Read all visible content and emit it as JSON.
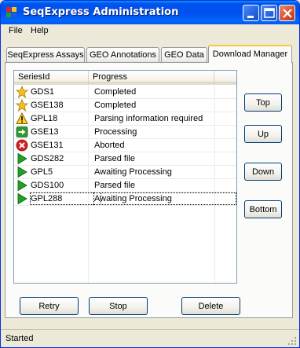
{
  "window": {
    "title": "SeqExpress Administration"
  },
  "menu": {
    "items": [
      "File",
      "Help"
    ]
  },
  "tabs": [
    "SeqExpress Assays",
    "GEO Annotations",
    "GEO Data",
    "Download Manager"
  ],
  "active_tab": "Download Manager",
  "list": {
    "columns": [
      "SeriesId",
      "Progress"
    ],
    "rows": [
      {
        "icon": "star-icon",
        "id": "GDS1",
        "progress": "Completed"
      },
      {
        "icon": "star-icon",
        "id": "GSE138",
        "progress": "Completed"
      },
      {
        "icon": "warning-icon",
        "id": "GPL18",
        "progress": "Parsing information required"
      },
      {
        "icon": "arrow-right-icon",
        "id": "GSE13",
        "progress": "Processing"
      },
      {
        "icon": "error-icon",
        "id": "GSE131",
        "progress": "Aborted"
      },
      {
        "icon": "play-icon",
        "id": "GDS282",
        "progress": "Parsed file"
      },
      {
        "icon": "play-icon",
        "id": "GPL5",
        "progress": "Awaiting Processing"
      },
      {
        "icon": "play-icon",
        "id": "GDS100",
        "progress": "Parsed file"
      },
      {
        "icon": "play-icon",
        "id": "GPL288",
        "progress": "Awaiting Processing"
      }
    ]
  },
  "order_buttons": {
    "top": "Top",
    "up": "Up",
    "down": "Down",
    "bottom": "Bottom"
  },
  "action_buttons": {
    "retry": "Retry",
    "stop": "Stop",
    "delete": "Delete"
  },
  "status": {
    "text": "Started"
  },
  "colors": {
    "titlebar": "#0054e3",
    "tab_highlight": "#ffc83c",
    "button_border": "#003c74",
    "face": "#ece9d8"
  }
}
